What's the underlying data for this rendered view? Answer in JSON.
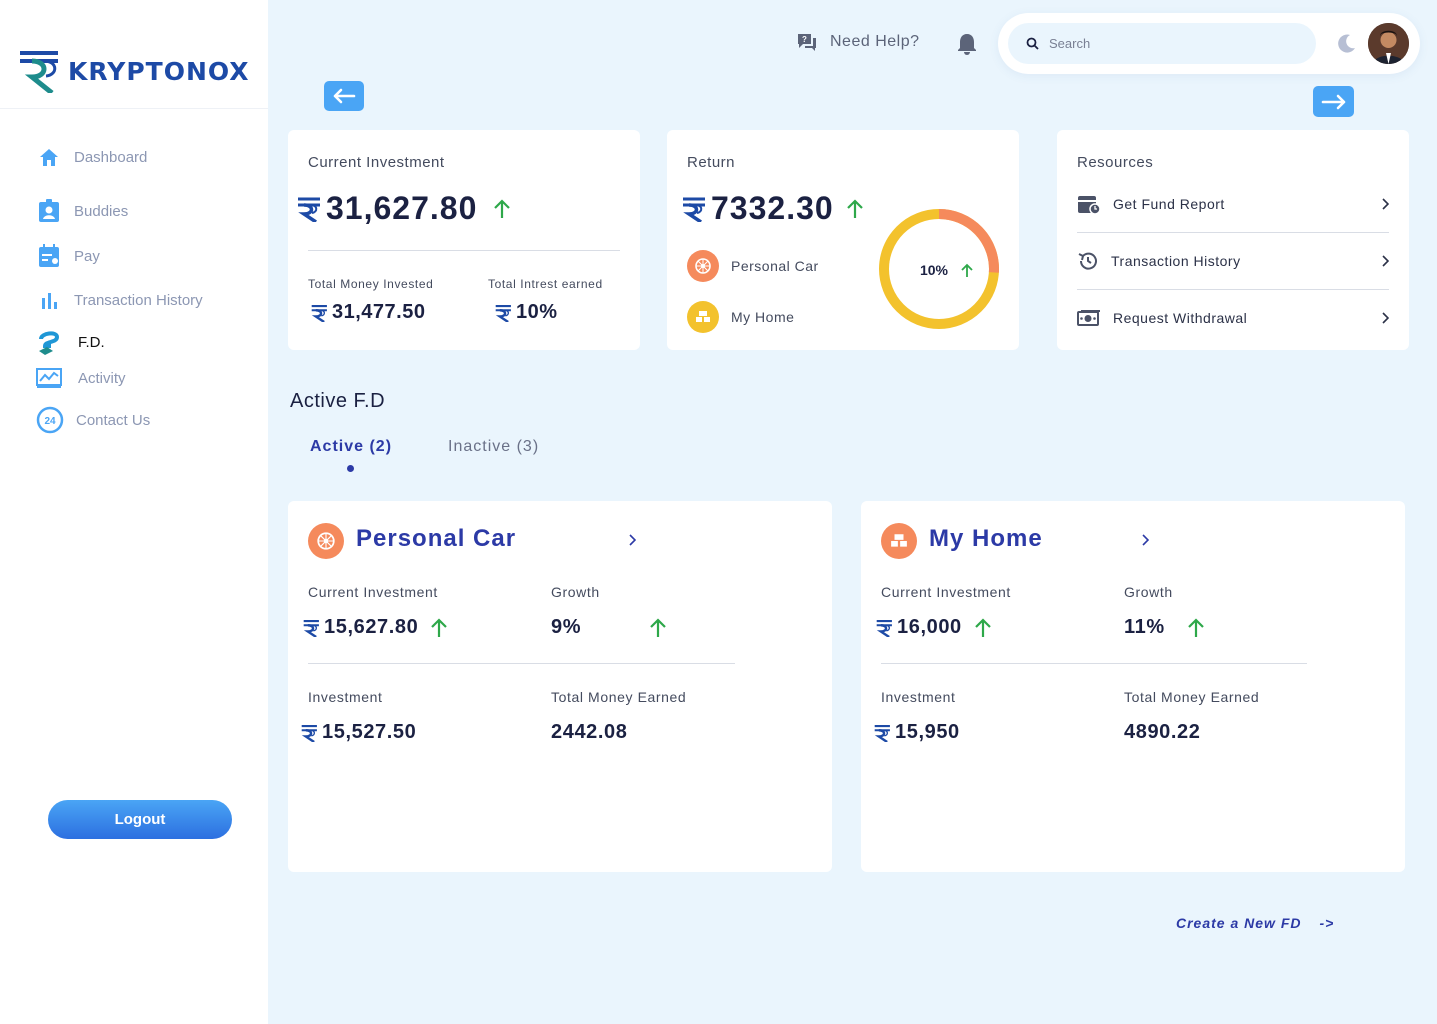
{
  "brand": {
    "name": "KRYPTONOX"
  },
  "sidebar": {
    "items": [
      {
        "label": "Dashboard",
        "icon": "home-icon"
      },
      {
        "label": "Buddies",
        "icon": "contact-card-icon"
      },
      {
        "label": "Pay",
        "icon": "calendar-pay-icon"
      },
      {
        "label": "Transaction History",
        "icon": "bar-chart-icon"
      },
      {
        "label": "F.D.",
        "icon": "fd-hand-icon"
      },
      {
        "label": "Activity",
        "icon": "activity-chart-icon"
      },
      {
        "label": "Contact Us",
        "icon": "support-24-icon"
      }
    ],
    "active": "F.D.",
    "logout_label": "Logout"
  },
  "topbar": {
    "help_label": "Need Help?",
    "search_placeholder": "Search"
  },
  "summary": {
    "current_investment": {
      "title": "Current Investment",
      "amount": "31,627.80",
      "total_invested_label": "Total Money Invested",
      "total_invested_value": "31,477.50",
      "interest_label": "Total Intrest earned",
      "interest_value": "10%"
    },
    "return": {
      "title": "Return",
      "amount": "7332.30",
      "legend": [
        "Personal Car",
        "My Home"
      ],
      "donut_label": "10%",
      "donut_share": 0.1
    },
    "resources": {
      "title": "Resources",
      "items": [
        "Get Fund Report",
        "Transaction History",
        "Request Withdrawal"
      ]
    }
  },
  "active_fd": {
    "title": "Active F.D",
    "tabs": [
      "Active (2)",
      "Inactive (3)"
    ],
    "cards": [
      {
        "name": "Personal Car",
        "current_investment_label": "Current Investment",
        "current_investment": "15,627.80",
        "growth_label": "Growth",
        "growth": "9%",
        "investment_label": "Investment",
        "investment": "15,527.50",
        "earned_label": "Total Money Earned",
        "earned": "2442.08"
      },
      {
        "name": "My Home",
        "current_investment_label": "Current Investment",
        "current_investment": "16,000",
        "growth_label": "Growth",
        "growth": "11%",
        "investment_label": "Investment",
        "investment": "15,950",
        "earned_label": "Total Money Earned",
        "earned": "4890.22"
      }
    ],
    "create_label": "Create a New FD",
    "create_arrow": "->"
  },
  "colors": {
    "accent": "#2c3aa6",
    "sky": "#4aa5f5",
    "up": "#2ea84a",
    "orange": "#f58a5c",
    "yellow": "#f3c22d"
  }
}
